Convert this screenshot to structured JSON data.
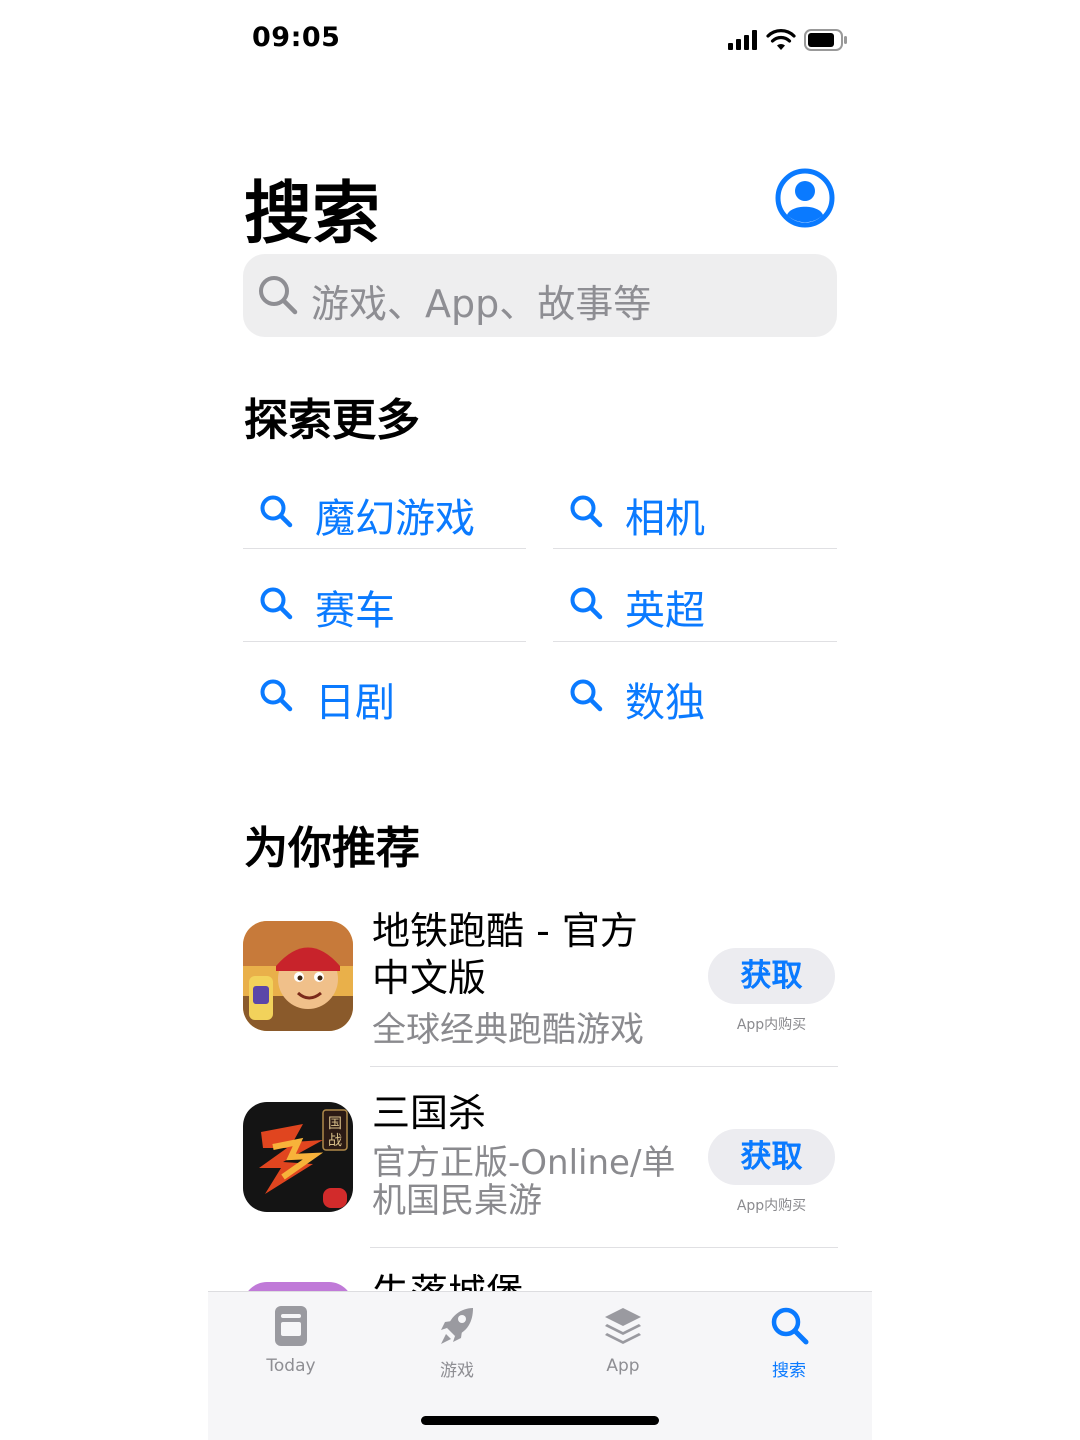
{
  "status_bar": {
    "time": "09:05"
  },
  "header": {
    "title": "搜索"
  },
  "search": {
    "placeholder": "游戏、App、故事等"
  },
  "explore": {
    "heading": "探索更多",
    "items": [
      {
        "label": "魔幻游戏"
      },
      {
        "label": "相机"
      },
      {
        "label": "赛车"
      },
      {
        "label": "英超"
      },
      {
        "label": "日剧"
      },
      {
        "label": "数独"
      }
    ]
  },
  "recommend": {
    "heading": "为你推荐",
    "apps": [
      {
        "name_line1": "地铁跑酷 - 官方",
        "name_line2": "中文版",
        "subtitle": "全球经典跑酷游戏",
        "button": "获取",
        "iap": "App内购买"
      },
      {
        "name_line1": "三国杀",
        "subtitle_line1": "官方正版-Online/单",
        "subtitle_line2": "机国民桌游",
        "button": "获取",
        "iap": "App内购买"
      },
      {
        "name_line1": "失落城堡"
      }
    ]
  },
  "tabbar": {
    "tabs": [
      {
        "label": "Today",
        "icon": "today-icon"
      },
      {
        "label": "游戏",
        "icon": "rocket-icon"
      },
      {
        "label": "App",
        "icon": "apps-stack-icon"
      },
      {
        "label": "搜索",
        "icon": "search-icon",
        "active": true
      }
    ]
  },
  "colors": {
    "accent": "#0a7aff",
    "secondary_text": "#8a8a8e",
    "field_bg": "#eeeeef"
  }
}
